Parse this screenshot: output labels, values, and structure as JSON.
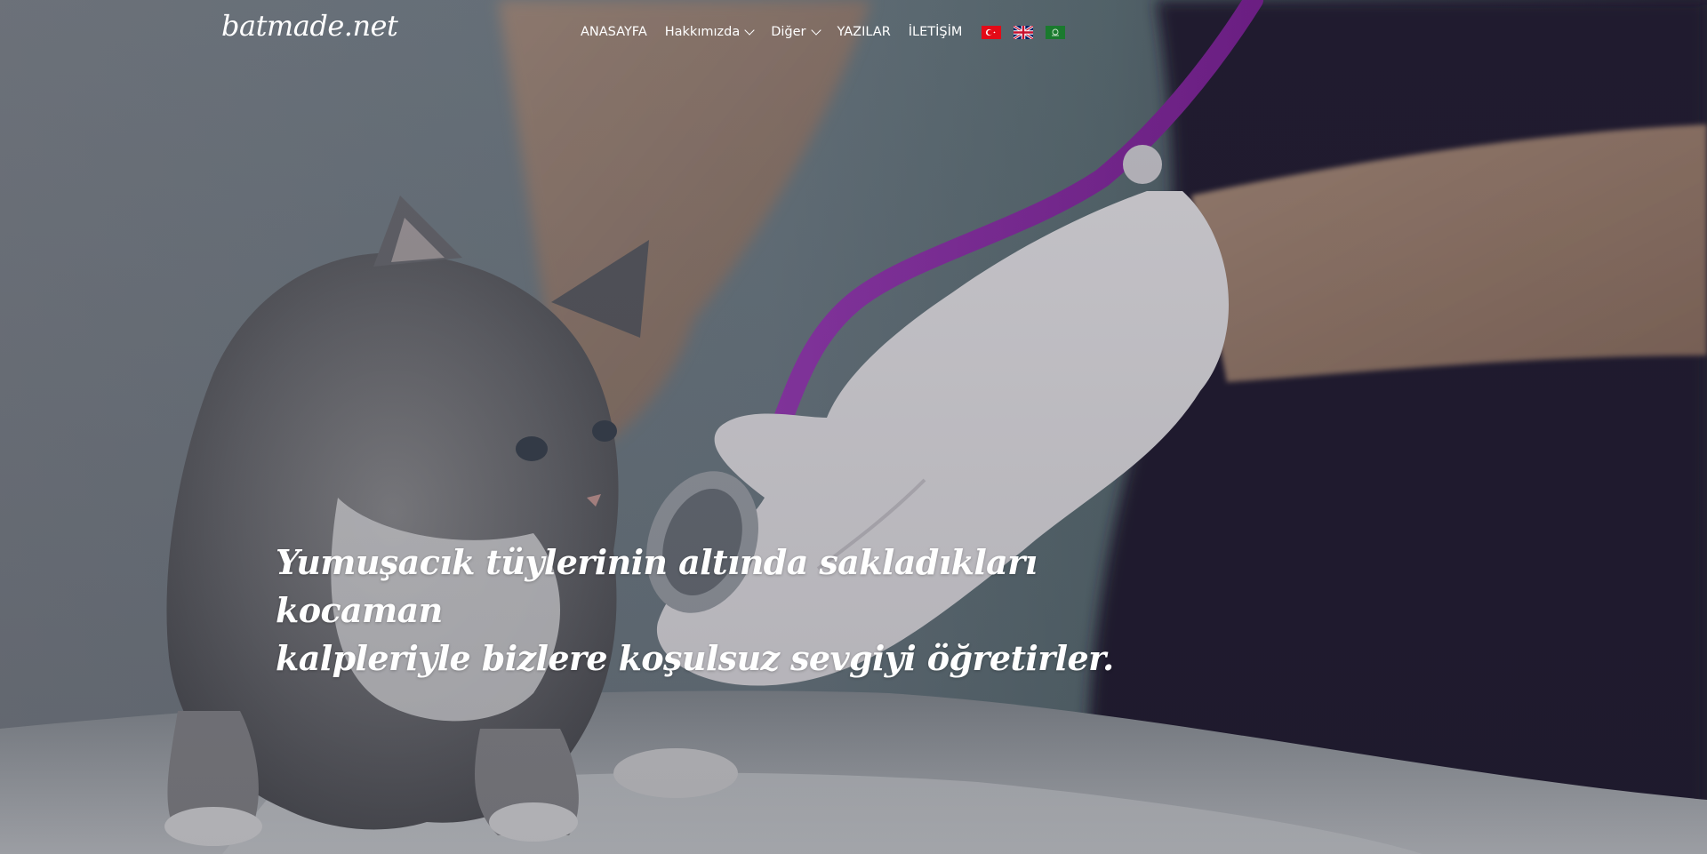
{
  "site": {
    "logo_text": "batmade.net"
  },
  "nav": {
    "items": [
      {
        "label": "ANASAYFA",
        "has_dropdown": false
      },
      {
        "label": "Hakkımızda",
        "has_dropdown": true
      },
      {
        "label": "Diğer",
        "has_dropdown": true
      },
      {
        "label": "YAZILAR",
        "has_dropdown": false
      },
      {
        "label": "İLETİŞİM",
        "has_dropdown": false
      }
    ],
    "languages": [
      {
        "icon": "turkey-flag-icon",
        "color": "#e30a17"
      },
      {
        "icon": "uk-flag-icon",
        "color": "#012169"
      },
      {
        "icon": "saudi-flag-icon",
        "color": "#1a7a2e"
      }
    ]
  },
  "hero": {
    "quote_line1": "Yumuşacık tüylerinin altında sakladıkları kocaman",
    "quote_line2": "kalpleriyle bizlere koşulsuz sevgiyi öğretirler."
  },
  "colors": {
    "text": "#ffffff",
    "stethoscope": "#8e2aa8",
    "glove": "#e8e6ea",
    "scrubs": "#241c33"
  }
}
